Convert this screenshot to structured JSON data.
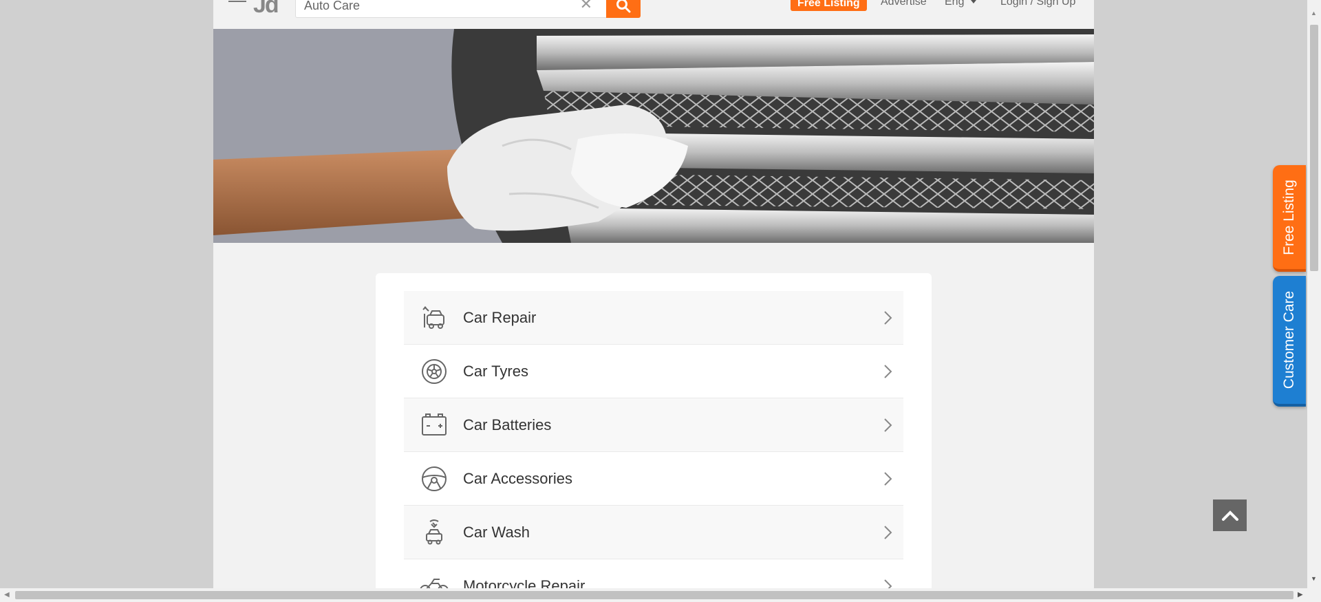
{
  "header": {
    "logo_text": "Jd",
    "search": {
      "value": "Auto Care",
      "placeholder": "Auto Care"
    },
    "free_listing": "Free Listing",
    "advertise": "Advertise",
    "language": "Eng",
    "login": "Login / Sign Up"
  },
  "categories": [
    {
      "label": "Car Repair",
      "icon": "car-repair-icon"
    },
    {
      "label": "Car Tyres",
      "icon": "tyre-icon"
    },
    {
      "label": "Car Batteries",
      "icon": "battery-icon"
    },
    {
      "label": "Car Accessories",
      "icon": "steering-wheel-icon"
    },
    {
      "label": "Car Wash",
      "icon": "car-wash-icon"
    },
    {
      "label": "Motorcycle Repair",
      "icon": "motorcycle-icon"
    }
  ],
  "side_tabs": {
    "free_listing": "Free Listing",
    "customer_care": "Customer Care"
  },
  "colors": {
    "accent_orange": "#ff6e14",
    "care_blue": "#1e7fd2"
  }
}
